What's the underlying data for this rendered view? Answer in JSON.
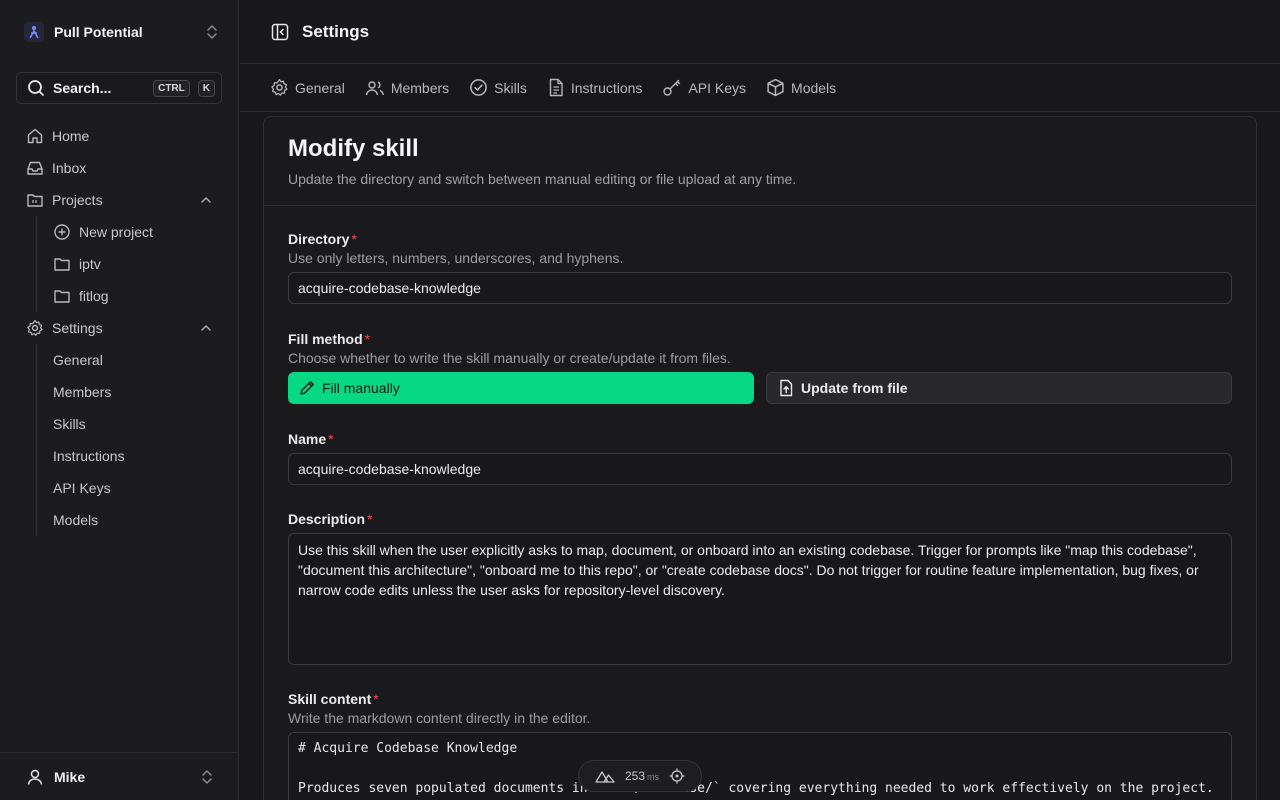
{
  "workspace": {
    "name": "Pull Potential"
  },
  "search": {
    "label": "Search...",
    "shortcut": [
      "CTRL",
      "K"
    ]
  },
  "sidebar": {
    "items": [
      {
        "label": "Home",
        "icon": "home-icon"
      },
      {
        "label": "Inbox",
        "icon": "inbox-icon"
      },
      {
        "label": "Projects",
        "icon": "folder-icon",
        "expanded": true
      }
    ],
    "projects": [
      {
        "label": "New project",
        "icon": "plus-circle-icon"
      },
      {
        "label": "iptv",
        "icon": "folder-icon"
      },
      {
        "label": "fitlog",
        "icon": "folder-icon"
      }
    ],
    "settings_label": "Settings",
    "settings": [
      "General",
      "Members",
      "Skills",
      "Instructions",
      "API Keys",
      "Models"
    ]
  },
  "user": {
    "name": "Mike"
  },
  "header": {
    "title": "Settings"
  },
  "tabs": [
    {
      "label": "General",
      "icon": "gear-icon"
    },
    {
      "label": "Members",
      "icon": "users-icon"
    },
    {
      "label": "Skills",
      "icon": "check-circle-icon"
    },
    {
      "label": "Instructions",
      "icon": "file-text-icon"
    },
    {
      "label": "API Keys",
      "icon": "key-icon"
    },
    {
      "label": "Models",
      "icon": "cube-icon"
    }
  ],
  "form": {
    "title": "Modify skill",
    "subtitle": "Update the directory and switch between manual editing or file upload at any time.",
    "directory": {
      "label": "Directory",
      "help": "Use only letters, numbers, underscores, and hyphens.",
      "value": "acquire-codebase-knowledge"
    },
    "fill_method": {
      "label": "Fill method",
      "help": "Choose whether to write the skill manually or create/update it from files.",
      "manual_label": "Fill manually",
      "file_label": "Update from file",
      "selected": "manual"
    },
    "name": {
      "label": "Name",
      "value": "acquire-codebase-knowledge"
    },
    "description": {
      "label": "Description",
      "value": "Use this skill when the user explicitly asks to map, document, or onboard into an existing codebase. Trigger for prompts like \"map this codebase\", \"document this architecture\", \"onboard me to this repo\", or \"create codebase docs\". Do not trigger for routine feature implementation, bug fixes, or narrow code edits unless the user asks for repository-level discovery."
    },
    "skill_content": {
      "label": "Skill content",
      "help": "Write the markdown content directly in the editor.",
      "line1": "# Acquire Codebase Knowledge",
      "line2": "",
      "line3": "Produces seven populated documents in `docs/codebase/` covering everything needed to work effectively on the project."
    },
    "required_mark": "*"
  },
  "devbar": {
    "timing": "253",
    "unit": "ms"
  },
  "colors": {
    "accent": "#06d883",
    "required": "#ef4a55",
    "background": "#18181a"
  }
}
